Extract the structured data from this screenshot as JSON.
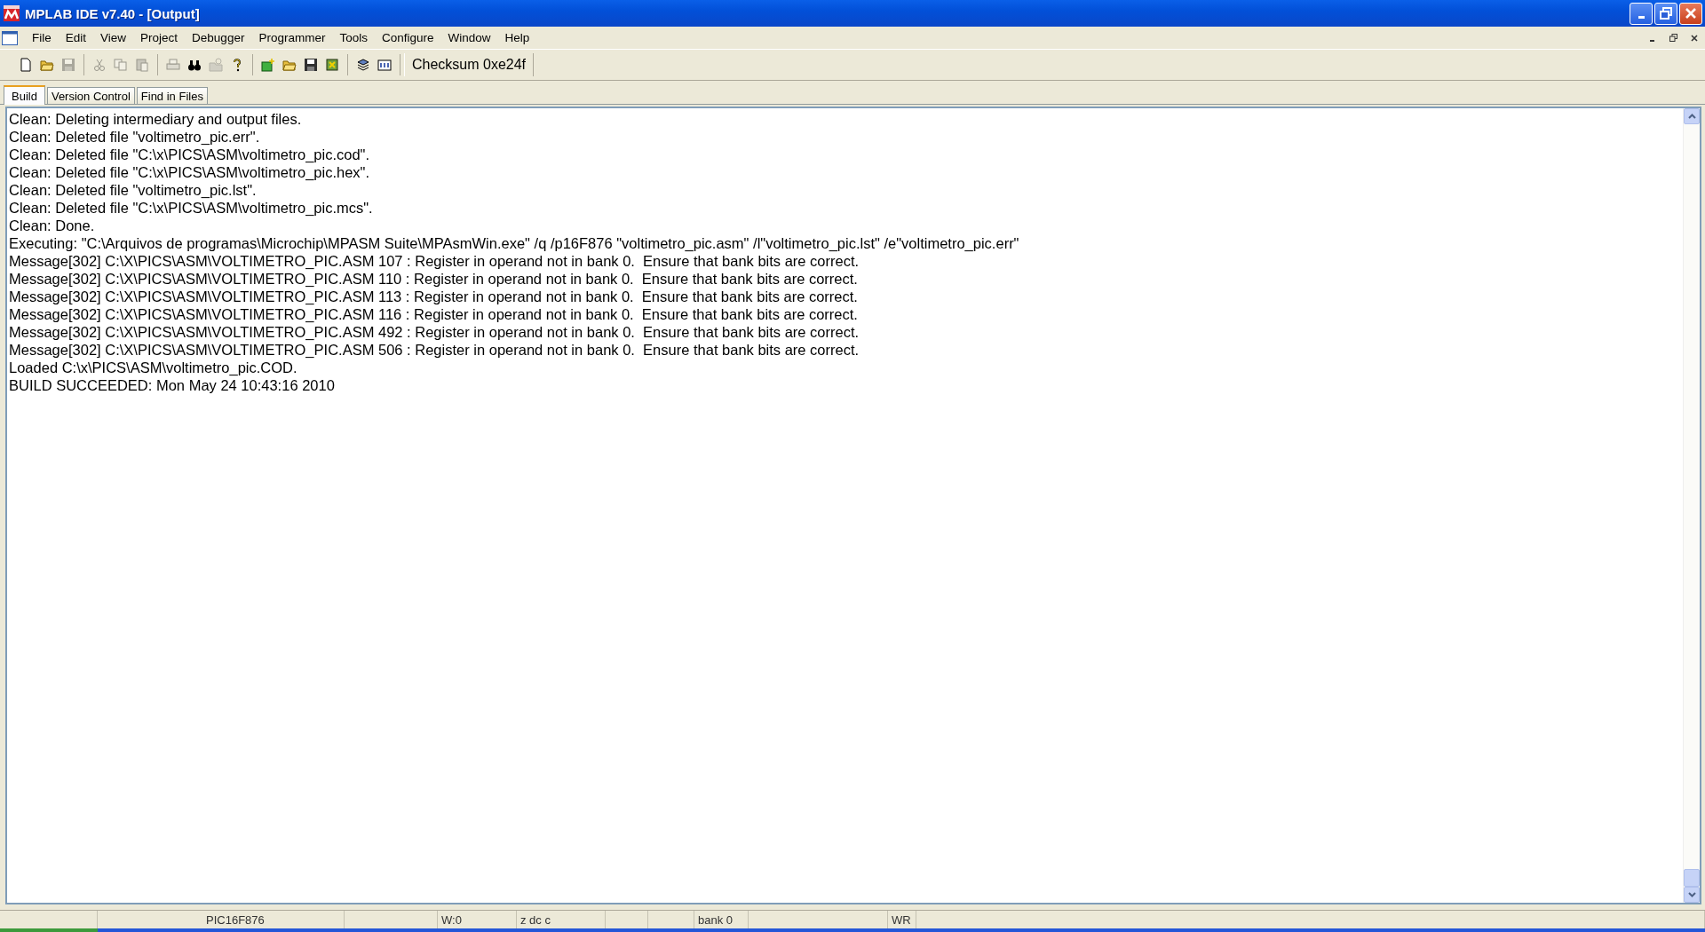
{
  "window": {
    "title": "MPLAB IDE v7.40 - [Output]"
  },
  "menu": [
    "File",
    "Edit",
    "View",
    "Project",
    "Debugger",
    "Programmer",
    "Tools",
    "Configure",
    "Window",
    "Help"
  ],
  "toolbar": {
    "groups": [
      [
        {
          "kind": "new-file",
          "disabled": false
        },
        {
          "kind": "open",
          "disabled": false
        },
        {
          "kind": "save",
          "disabled": true
        }
      ],
      [
        {
          "kind": "cut",
          "disabled": true
        },
        {
          "kind": "copy",
          "disabled": true
        },
        {
          "kind": "paste",
          "disabled": true
        }
      ],
      [
        {
          "kind": "print",
          "disabled": true
        },
        {
          "kind": "find",
          "disabled": false
        },
        {
          "kind": "find-files",
          "disabled": true
        },
        {
          "kind": "help",
          "disabled": false
        }
      ],
      [
        {
          "kind": "new-project",
          "disabled": false
        },
        {
          "kind": "open",
          "disabled": false
        },
        {
          "kind": "save",
          "disabled": false
        },
        {
          "kind": "build",
          "disabled": false
        }
      ],
      [
        {
          "kind": "layers",
          "disabled": false
        },
        {
          "kind": "program",
          "disabled": false
        }
      ]
    ],
    "checksum": "Checksum 0xe24f"
  },
  "tabs": [
    {
      "label": "Build",
      "selected": true
    },
    {
      "label": "Version Control",
      "selected": false
    },
    {
      "label": "Find in Files",
      "selected": false
    }
  ],
  "output_lines": [
    "Clean: Deleting intermediary and output files.",
    "Clean: Deleted file \"voltimetro_pic.err\".",
    "Clean: Deleted file \"C:\\x\\PICS\\ASM\\voltimetro_pic.cod\".",
    "Clean: Deleted file \"C:\\x\\PICS\\ASM\\voltimetro_pic.hex\".",
    "Clean: Deleted file \"voltimetro_pic.lst\".",
    "Clean: Deleted file \"C:\\x\\PICS\\ASM\\voltimetro_pic.mcs\".",
    "Clean: Done.",
    "Executing: \"C:\\Arquivos de programas\\Microchip\\MPASM Suite\\MPAsmWin.exe\" /q /p16F876 \"voltimetro_pic.asm\" /l\"voltimetro_pic.lst\" /e\"voltimetro_pic.err\"",
    "Message[302] C:\\X\\PICS\\ASM\\VOLTIMETRO_PIC.ASM 107 : Register in operand not in bank 0.  Ensure that bank bits are correct.",
    "Message[302] C:\\X\\PICS\\ASM\\VOLTIMETRO_PIC.ASM 110 : Register in operand not in bank 0.  Ensure that bank bits are correct.",
    "Message[302] C:\\X\\PICS\\ASM\\VOLTIMETRO_PIC.ASM 113 : Register in operand not in bank 0.  Ensure that bank bits are correct.",
    "Message[302] C:\\X\\PICS\\ASM\\VOLTIMETRO_PIC.ASM 116 : Register in operand not in bank 0.  Ensure that bank bits are correct.",
    "Message[302] C:\\X\\PICS\\ASM\\VOLTIMETRO_PIC.ASM 492 : Register in operand not in bank 0.  Ensure that bank bits are correct.",
    "Message[302] C:\\X\\PICS\\ASM\\VOLTIMETRO_PIC.ASM 506 : Register in operand not in bank 0.  Ensure that bank bits are correct.",
    "Loaded C:\\x\\PICS\\ASM\\voltimetro_pic.COD.",
    "BUILD SUCCEEDED: Mon May 24 10:43:16 2010"
  ],
  "status_bar": {
    "device": "PIC16F876",
    "w_register": "W:0",
    "flags": "z dc c",
    "bank": "bank 0",
    "mode": "WR"
  }
}
